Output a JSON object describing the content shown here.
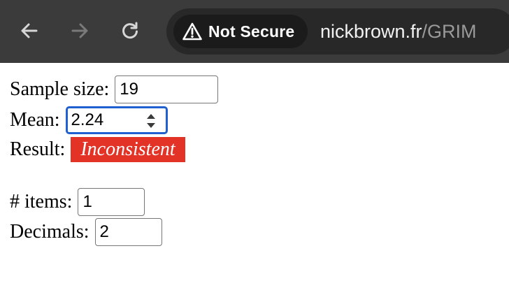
{
  "browser": {
    "security_label": "Not Secure",
    "url_host": "nickbrown.fr",
    "url_path": "/GRIM",
    "icons": {
      "back": "back-arrow-icon",
      "forward": "forward-arrow-icon",
      "reload": "reload-icon",
      "security": "warning-triangle-icon"
    }
  },
  "form": {
    "sample_size_label": "Sample size:",
    "sample_size_value": "19",
    "mean_label": "Mean:",
    "mean_value": "2.24",
    "result_label": "Result:",
    "result_value": "Inconsistent",
    "items_label": "# items:",
    "items_value": "1",
    "decimals_label": "Decimals:",
    "decimals_value": "2"
  },
  "colors": {
    "toolbar_bg": "#3b3b3b",
    "focus_ring": "#1f5fd0",
    "inconsistent_bg": "#e33327"
  }
}
